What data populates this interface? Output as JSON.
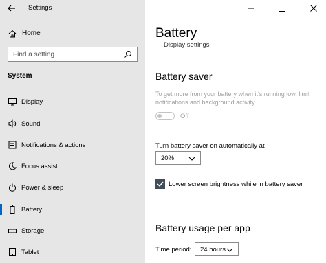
{
  "window": {
    "title": "Settings"
  },
  "sidebar": {
    "home_label": "Home",
    "search_placeholder": "Find a setting",
    "section_label": "System",
    "items": [
      {
        "label": "Display",
        "icon": "display-icon"
      },
      {
        "label": "Sound",
        "icon": "sound-icon"
      },
      {
        "label": "Notifications & actions",
        "icon": "notifications-icon"
      },
      {
        "label": "Focus assist",
        "icon": "focus-assist-icon"
      },
      {
        "label": "Power & sleep",
        "icon": "power-icon"
      },
      {
        "label": "Battery",
        "icon": "battery-icon",
        "active": true
      },
      {
        "label": "Storage",
        "icon": "storage-icon"
      },
      {
        "label": "Tablet",
        "icon": "tablet-icon"
      }
    ]
  },
  "main": {
    "title": "Battery",
    "sub_link": "Display settings",
    "battery_saver": {
      "heading": "Battery saver",
      "description": "To get more from your battery when it's running low, limit notifications and background activity.",
      "toggle_state": "Off",
      "auto_label": "Turn battery saver on automatically at",
      "auto_value": "20%",
      "brightness_label": "Lower screen brightness while in battery saver",
      "brightness_checked": true
    },
    "usage": {
      "heading": "Battery usage per app",
      "period_label": "Time period:",
      "period_value": "24 hours"
    }
  },
  "colors": {
    "accent": "#0067c0",
    "sidebar_bg": "#e6e6e6",
    "checkbox": "#414e5a"
  }
}
